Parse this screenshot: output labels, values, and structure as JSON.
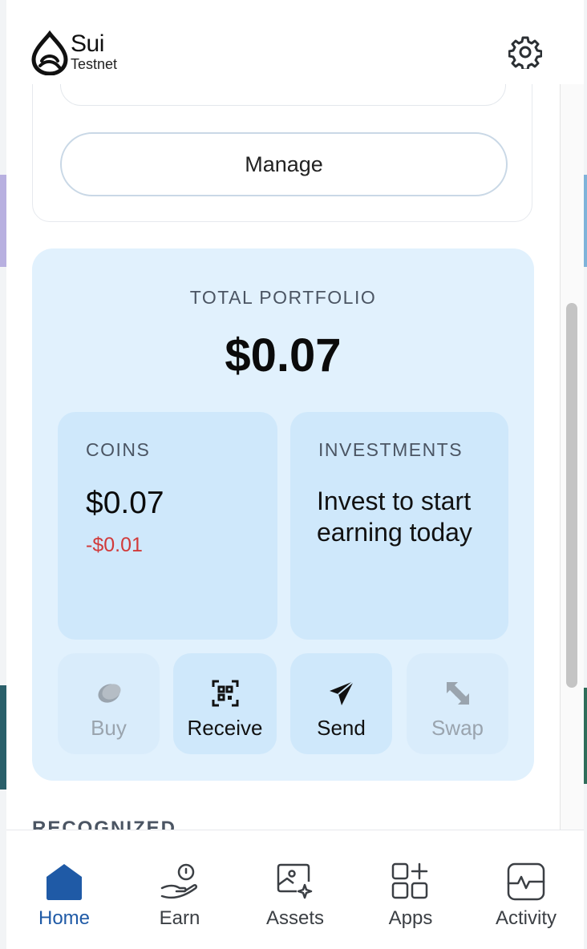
{
  "header": {
    "brand_name": "Sui",
    "network": "Testnet",
    "settings_icon": "gear-icon"
  },
  "account_card": {
    "manage_label": "Manage"
  },
  "portfolio": {
    "title": "TOTAL PORTFOLIO",
    "total_value": "$0.07",
    "coins": {
      "label": "COINS",
      "value": "$0.07",
      "change": "-$0.01"
    },
    "investments": {
      "label": "INVESTMENTS",
      "message": "Invest to start earning today"
    },
    "actions": [
      {
        "label": "Buy",
        "icon": "coin-icon",
        "enabled": false
      },
      {
        "label": "Receive",
        "icon": "qr-code-icon",
        "enabled": true
      },
      {
        "label": "Send",
        "icon": "paper-plane-icon",
        "enabled": true
      },
      {
        "label": "Swap",
        "icon": "swap-arrows-icon",
        "enabled": false
      }
    ]
  },
  "section_heading": "RECOGNIZED",
  "nav": {
    "items": [
      {
        "label": "Home",
        "icon": "home-icon",
        "active": true
      },
      {
        "label": "Earn",
        "icon": "earn-hand-coin-icon",
        "active": false
      },
      {
        "label": "Assets",
        "icon": "assets-image-icon",
        "active": false
      },
      {
        "label": "Apps",
        "icon": "apps-grid-icon",
        "active": false
      },
      {
        "label": "Activity",
        "icon": "activity-pulse-icon",
        "active": false
      }
    ]
  },
  "colors": {
    "accent": "#1f5aa6",
    "portfolio_bg": "#e1f1fd",
    "card_bg": "#cfe8fb",
    "negative": "#d13a3a"
  }
}
